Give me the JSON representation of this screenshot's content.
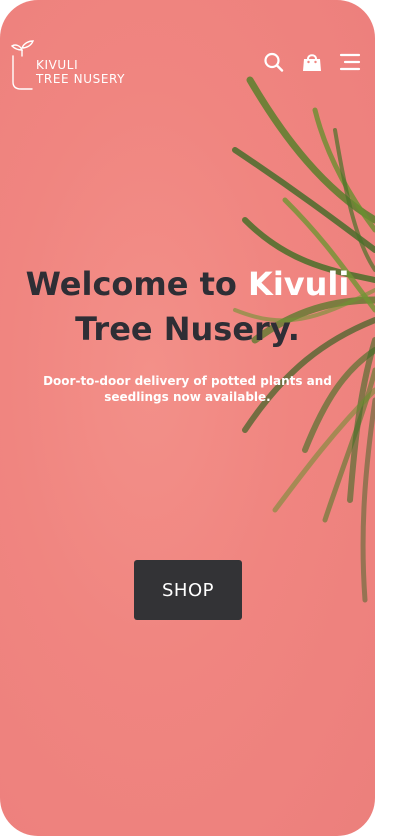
{
  "brand": {
    "line1": "KIVULI",
    "line2": "TREE NUSERY",
    "logo_icon": "potted-sprout-icon"
  },
  "header": {
    "icons": [
      "search-icon",
      "shopping-bag-icon",
      "hamburger-menu-icon"
    ]
  },
  "hero": {
    "title_part1": "Welcome to",
    "title_accent": "Kivuli",
    "title_part2": "Tree Nusery.",
    "subtitle": "Door-to-door delivery of potted plants and seedlings now available."
  },
  "cta": {
    "label": "SHOP"
  },
  "colors": {
    "background": "#F08580",
    "title_text": "#2E2E35",
    "accent": "#FFFFFF",
    "button": "#333336",
    "plant": "#4E7A2E"
  }
}
